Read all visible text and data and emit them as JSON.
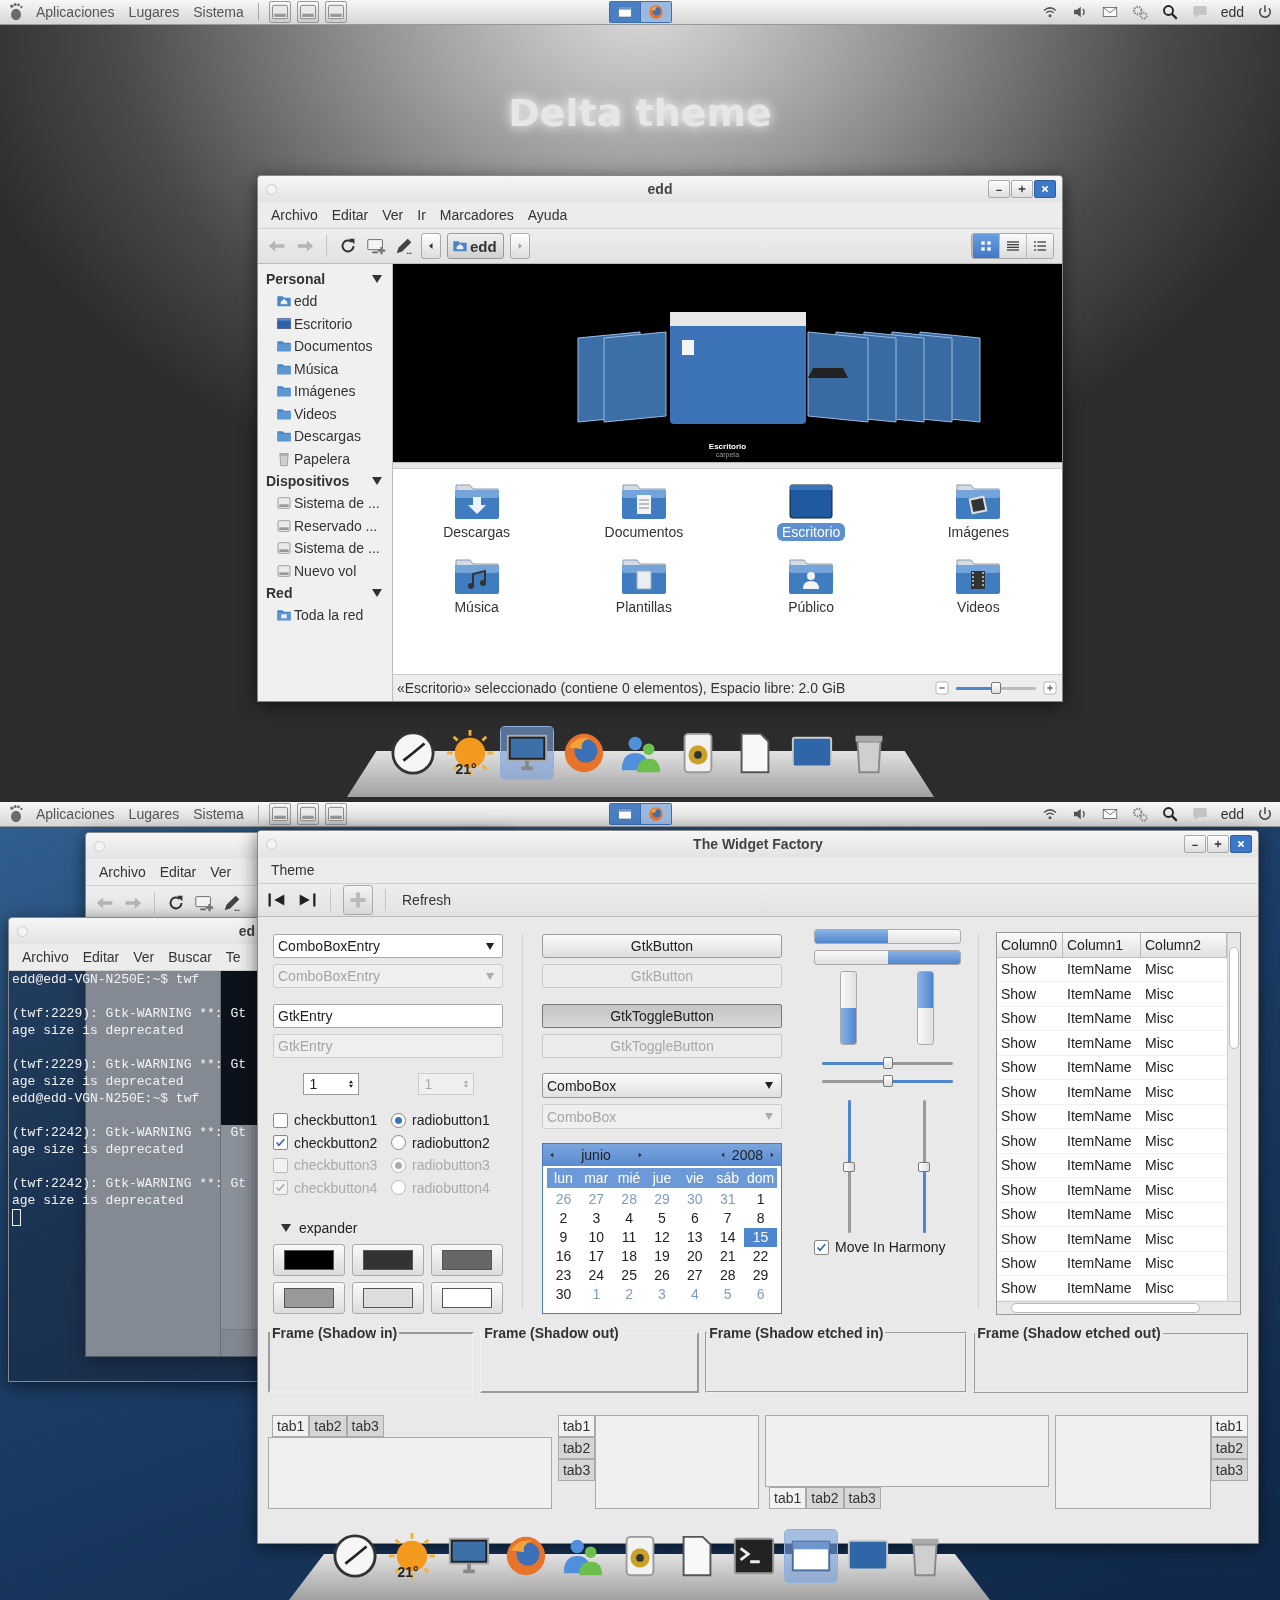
{
  "top_desktop": {
    "panel": {
      "menus": [
        "Aplicaciones",
        "Lugares",
        "Sistema"
      ],
      "launchers": [
        {
          "kind": "drive"
        },
        {
          "kind": "drive"
        },
        {
          "kind": "drive"
        }
      ],
      "tasks": [
        {
          "kind": "window",
          "selected": true
        },
        {
          "kind": "browser",
          "selected": false
        }
      ],
      "tray": [
        {
          "kind": "wifi"
        },
        {
          "kind": "volume"
        },
        {
          "kind": "mail"
        },
        {
          "kind": "gears"
        },
        {
          "kind": "search"
        },
        {
          "kind": "chat"
        }
      ],
      "user": "edd"
    },
    "title": "Delta theme",
    "file_manager": {
      "title": "edd",
      "menus": [
        "Archivo",
        "Editar",
        "Ver",
        "Ir",
        "Marcadores",
        "Ayuda"
      ],
      "location": "edd",
      "views": [
        {
          "kind": "icons",
          "selected": true
        },
        {
          "kind": "list",
          "selected": false
        },
        {
          "kind": "compact",
          "selected": false
        }
      ],
      "sidebar": [
        {
          "heading": "Personal",
          "expanded": true,
          "items": [
            {
              "label": "edd",
              "kind": "home"
            },
            {
              "label": "Escritorio",
              "kind": "desktop"
            },
            {
              "label": "Documentos",
              "kind": "folder"
            },
            {
              "label": "Música",
              "kind": "folder"
            },
            {
              "label": "Imágenes",
              "kind": "folder"
            },
            {
              "label": "Videos",
              "kind": "folder"
            },
            {
              "label": "Descargas",
              "kind": "folder"
            },
            {
              "label": "Papelera",
              "kind": "trash"
            }
          ]
        },
        {
          "heading": "Dispositivos",
          "expanded": true,
          "items": [
            {
              "label": "Sistema de ...",
              "kind": "drive"
            },
            {
              "label": "Reservado ...",
              "kind": "drive"
            },
            {
              "label": "Sistema de ...",
              "kind": "drive"
            },
            {
              "label": "Nuevo vol",
              "kind": "drive"
            }
          ]
        },
        {
          "heading": "Red",
          "expanded": true,
          "items": [
            {
              "label": "Toda la red",
              "kind": "network"
            }
          ]
        }
      ],
      "preview": {
        "caption": "Escritorio",
        "subcaption": "carpeta"
      },
      "files": [
        {
          "label": "Descargas",
          "kind": "download",
          "selected": false
        },
        {
          "label": "Documentos",
          "kind": "documents",
          "selected": false
        },
        {
          "label": "Escritorio",
          "kind": "desktop",
          "selected": true
        },
        {
          "label": "Imágenes",
          "kind": "pictures",
          "selected": false
        },
        {
          "label": "Música",
          "kind": "music",
          "selected": false
        },
        {
          "label": "Plantillas",
          "kind": "templates",
          "selected": false
        },
        {
          "label": "Público",
          "kind": "public",
          "selected": false
        },
        {
          "label": "Videos",
          "kind": "videos",
          "selected": false
        }
      ],
      "status": "«Escritorio» seleccionado (contiene 0 elementos), Espacio libre: 2.0 GiB",
      "zoom": {
        "level": 0.5
      }
    },
    "dock": [
      {
        "kind": "clock",
        "active": false
      },
      {
        "kind": "weather",
        "label": "21°",
        "active": false
      },
      {
        "kind": "monitor",
        "active": true
      },
      {
        "kind": "browser",
        "active": false
      },
      {
        "kind": "people",
        "active": false
      },
      {
        "kind": "speaker",
        "active": false
      },
      {
        "kind": "document",
        "active": false
      },
      {
        "kind": "screen",
        "active": false
      },
      {
        "kind": "trash",
        "active": false
      }
    ]
  },
  "bottom_desktop": {
    "panel": {
      "menus": [
        "Aplicaciones",
        "Lugares",
        "Sistema"
      ],
      "launchers": [
        {
          "kind": "drive"
        },
        {
          "kind": "drive"
        },
        {
          "kind": "drive"
        }
      ],
      "tasks": [
        {
          "kind": "window",
          "selected": true
        },
        {
          "kind": "browser",
          "selected": false
        }
      ],
      "tray": [
        {
          "kind": "wifi"
        },
        {
          "kind": "volume"
        },
        {
          "kind": "mail"
        },
        {
          "kind": "gears"
        },
        {
          "kind": "search"
        },
        {
          "kind": "chat"
        }
      ],
      "user": "edd"
    },
    "back_window": {
      "menus": [
        "Archivo",
        "Editar",
        "Ver"
      ]
    },
    "terminal": {
      "title": "ed",
      "menus": [
        "Archivo",
        "Editar",
        "Ver",
        "Buscar",
        "Te"
      ],
      "blocks": [
        [
          "edd@edd-VGN-N250E:~$ twf"
        ],
        [
          "(twf:2229): Gtk-WARNING **: Gt",
          "age size is deprecated"
        ],
        [
          "(twf:2229): Gtk-WARNING **: Gt",
          "age size is deprecated",
          "edd@edd-VGN-N250E:~$ twf"
        ],
        [
          "(twf:2242): Gtk-WARNING **: Gt",
          "age size is deprecated"
        ],
        [
          "(twf:2242): Gtk-WARNING **: Gt",
          "age size is deprecated"
        ]
      ]
    },
    "widget_factory": {
      "title": "The Widget Factory",
      "menus": [
        "Theme"
      ],
      "refresh_label": "Refresh",
      "combo_entries": [
        {
          "value": "ComboBoxEntry",
          "disabled": false
        },
        {
          "value": "ComboBoxEntry",
          "disabled": true
        }
      ],
      "entries": [
        {
          "value": "GtkEntry",
          "disabled": false
        },
        {
          "value": "GtkEntry",
          "disabled": true
        }
      ],
      "spins": [
        {
          "value": "1",
          "disabled": false
        },
        {
          "value": "1",
          "disabled": true
        }
      ],
      "checks": [
        {
          "label": "checkbutton1",
          "checked": false,
          "disabled": false
        },
        {
          "label": "checkbutton2",
          "checked": true,
          "disabled": false
        },
        {
          "label": "checkbutton3",
          "checked": false,
          "disabled": true
        },
        {
          "label": "checkbutton4",
          "checked": true,
          "disabled": true
        }
      ],
      "radios": [
        {
          "label": "radiobutton1",
          "selected": true,
          "disabled": false
        },
        {
          "label": "radiobutton2",
          "selected": false,
          "disabled": false
        },
        {
          "label": "radiobutton3",
          "selected": true,
          "disabled": true
        },
        {
          "label": "radiobutton4",
          "selected": false,
          "disabled": true
        }
      ],
      "expander": {
        "label": "expander",
        "expanded": true
      },
      "swatches": [
        {
          "color": "#000000"
        },
        {
          "color": "#333333"
        },
        {
          "color": "#666666"
        },
        {
          "color": "#999999"
        },
        {
          "color": "#dddddd"
        },
        {
          "color": "#ffffff"
        }
      ],
      "buttons": [
        {
          "label": "GtkButton",
          "kind": "button",
          "pressed": false,
          "disabled": false
        },
        {
          "label": "GtkButton",
          "kind": "button",
          "pressed": false,
          "disabled": true
        },
        {
          "label": "GtkToggleButton",
          "kind": "toggle",
          "pressed": true,
          "disabled": false
        },
        {
          "label": "GtkToggleButton",
          "kind": "toggle",
          "pressed": false,
          "disabled": true
        }
      ],
      "combos": [
        {
          "value": "ComboBox",
          "disabled": false
        },
        {
          "value": "ComboBox",
          "disabled": true
        }
      ],
      "calendar": {
        "month": "junio",
        "year": "2008",
        "weekdays": [
          "lun",
          "mar",
          "mié",
          "jue",
          "vie",
          "sáb",
          "dom"
        ],
        "days": [
          {
            "label": "26",
            "other_month": true,
            "selected": false
          },
          {
            "label": "27",
            "other_month": true,
            "selected": false
          },
          {
            "label": "28",
            "other_month": true,
            "selected": false
          },
          {
            "label": "29",
            "other_month": true,
            "selected": false
          },
          {
            "label": "30",
            "other_month": true,
            "selected": false
          },
          {
            "label": "31",
            "other_month": true,
            "selected": false
          },
          {
            "label": "1",
            "other_month": false,
            "selected": false
          },
          {
            "label": "2",
            "other_month": false,
            "selected": false
          },
          {
            "label": "3",
            "other_month": false,
            "selected": false
          },
          {
            "label": "4",
            "other_month": false,
            "selected": false
          },
          {
            "label": "5",
            "other_month": false,
            "selected": false
          },
          {
            "label": "6",
            "other_month": false,
            "selected": false
          },
          {
            "label": "7",
            "other_month": false,
            "selected": false
          },
          {
            "label": "8",
            "other_month": false,
            "selected": false
          },
          {
            "label": "9",
            "other_month": false,
            "selected": false
          },
          {
            "label": "10",
            "other_month": false,
            "selected": false
          },
          {
            "label": "11",
            "other_month": false,
            "selected": false
          },
          {
            "label": "12",
            "other_month": false,
            "selected": false
          },
          {
            "label": "13",
            "other_month": false,
            "selected": false
          },
          {
            "label": "14",
            "other_month": false,
            "selected": false
          },
          {
            "label": "15",
            "other_month": false,
            "selected": true
          },
          {
            "label": "16",
            "other_month": false,
            "selected": false
          },
          {
            "label": "17",
            "other_month": false,
            "selected": false
          },
          {
            "label": "18",
            "other_month": false,
            "selected": false
          },
          {
            "label": "19",
            "other_month": false,
            "selected": false
          },
          {
            "label": "20",
            "other_month": false,
            "selected": false
          },
          {
            "label": "21",
            "other_month": false,
            "selected": false
          },
          {
            "label": "22",
            "other_month": false,
            "selected": false
          },
          {
            "label": "23",
            "other_month": false,
            "selected": false
          },
          {
            "label": "24",
            "other_month": false,
            "selected": false
          },
          {
            "label": "25",
            "other_month": false,
            "selected": false
          },
          {
            "label": "26",
            "other_month": false,
            "selected": false
          },
          {
            "label": "27",
            "other_month": false,
            "selected": false
          },
          {
            "label": "28",
            "other_month": false,
            "selected": false
          },
          {
            "label": "29",
            "other_month": false,
            "selected": false
          },
          {
            "label": "30",
            "other_month": false,
            "selected": false
          },
          {
            "label": "1",
            "other_month": true,
            "selected": false
          },
          {
            "label": "2",
            "other_month": true,
            "selected": false
          },
          {
            "label": "3",
            "other_month": true,
            "selected": false
          },
          {
            "label": "4",
            "other_month": true,
            "selected": false
          },
          {
            "label": "5",
            "other_month": true,
            "selected": false
          },
          {
            "label": "6",
            "other_month": true,
            "selected": false
          }
        ]
      },
      "bars": [
        {
          "kind": "progress_h",
          "inverted": false,
          "level": 0.5
        },
        {
          "kind": "progress_h",
          "inverted": true,
          "level": 0.5
        },
        {
          "kind": "progress_v",
          "inverted": false,
          "level": 0.5
        },
        {
          "kind": "progress_v",
          "inverted": true,
          "level": 0.5
        },
        {
          "kind": "scale_h",
          "inverted": false,
          "level": 0.5
        },
        {
          "kind": "scale_h",
          "inverted": true,
          "level": 0.5
        },
        {
          "kind": "scale_v",
          "inverted": false,
          "level": 0.5
        },
        {
          "kind": "scale_v",
          "inverted": true,
          "level": 0.5
        }
      ],
      "harmony": {
        "label": "Move In Harmony",
        "checked": true
      },
      "tree": {
        "columns": [
          "Column0",
          "Column1",
          "Column2"
        ],
        "rows": [
          [
            "Show",
            "ItemName",
            "Misc"
          ],
          [
            "Show",
            "ItemName",
            "Misc"
          ],
          [
            "Show",
            "ItemName",
            "Misc"
          ],
          [
            "Show",
            "ItemName",
            "Misc"
          ],
          [
            "Show",
            "ItemName",
            "Misc"
          ],
          [
            "Show",
            "ItemName",
            "Misc"
          ],
          [
            "Show",
            "ItemName",
            "Misc"
          ],
          [
            "Show",
            "ItemName",
            "Misc"
          ],
          [
            "Show",
            "ItemName",
            "Misc"
          ],
          [
            "Show",
            "ItemName",
            "Misc"
          ],
          [
            "Show",
            "ItemName",
            "Misc"
          ],
          [
            "Show",
            "ItemName",
            "Misc"
          ],
          [
            "Show",
            "ItemName",
            "Misc"
          ],
          [
            "Show",
            "ItemName",
            "Misc"
          ]
        ]
      },
      "frames": [
        {
          "label": "Frame (Shadow in)",
          "kind": "in"
        },
        {
          "label": "Frame (Shadow out)",
          "kind": "out"
        },
        {
          "label": "Frame (Shadow etched in)",
          "kind": "etched_in"
        },
        {
          "label": "Frame (Shadow etched out)",
          "kind": "etched_out"
        }
      ],
      "notebooks": [
        {
          "kind": "top",
          "tabs": [
            {
              "label": "tab1",
              "selected": true
            },
            {
              "label": "tab2",
              "selected": false
            },
            {
              "label": "tab3",
              "selected": false
            }
          ]
        },
        {
          "kind": "left",
          "tabs": [
            {
              "label": "tab1",
              "selected": true
            },
            {
              "label": "tab2",
              "selected": false
            },
            {
              "label": "tab3",
              "selected": false
            }
          ]
        },
        {
          "kind": "bottom",
          "tabs": [
            {
              "label": "tab1",
              "selected": true
            },
            {
              "label": "tab2",
              "selected": false
            },
            {
              "label": "tab3",
              "selected": false
            }
          ]
        },
        {
          "kind": "right",
          "tabs": [
            {
              "label": "tab1",
              "selected": true
            },
            {
              "label": "tab2",
              "selected": false
            },
            {
              "label": "tab3",
              "selected": false
            }
          ]
        }
      ]
    },
    "dock": [
      {
        "kind": "clock",
        "active": false
      },
      {
        "kind": "weather",
        "label": "21°",
        "active": false
      },
      {
        "kind": "monitor",
        "active": false
      },
      {
        "kind": "browser",
        "active": false
      },
      {
        "kind": "people",
        "active": false
      },
      {
        "kind": "speaker",
        "active": false
      },
      {
        "kind": "document",
        "active": false
      },
      {
        "kind": "terminal",
        "active": false
      },
      {
        "kind": "window",
        "active": true
      },
      {
        "kind": "screen",
        "active": false
      },
      {
        "kind": "trash",
        "active": false
      }
    ]
  }
}
